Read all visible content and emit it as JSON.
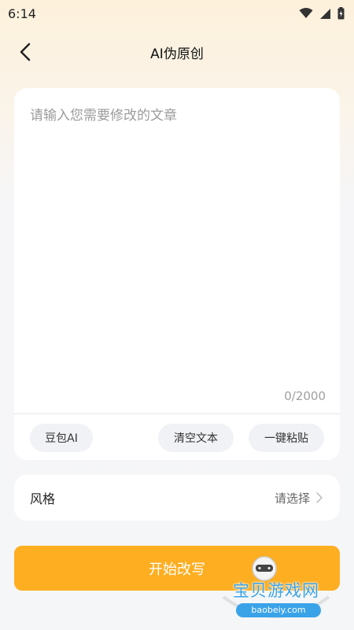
{
  "status_bar": {
    "time": "6:14"
  },
  "header": {
    "title": "AI伪原创"
  },
  "editor": {
    "placeholder": "请输入您需要修改的文章",
    "value": "",
    "char_count": "0/2000",
    "buttons": {
      "doubao": "豆包AI",
      "clear": "清空文本",
      "paste": "一键粘贴"
    }
  },
  "style": {
    "label": "风格",
    "value": "请选择"
  },
  "action": {
    "start_label": "开始改写"
  },
  "watermark": {
    "name": "宝贝游戏网",
    "url": "baobeiy.com"
  },
  "colors": {
    "accent": "#fdae21",
    "card": "#ffffff",
    "pill": "#f1f2f5"
  }
}
